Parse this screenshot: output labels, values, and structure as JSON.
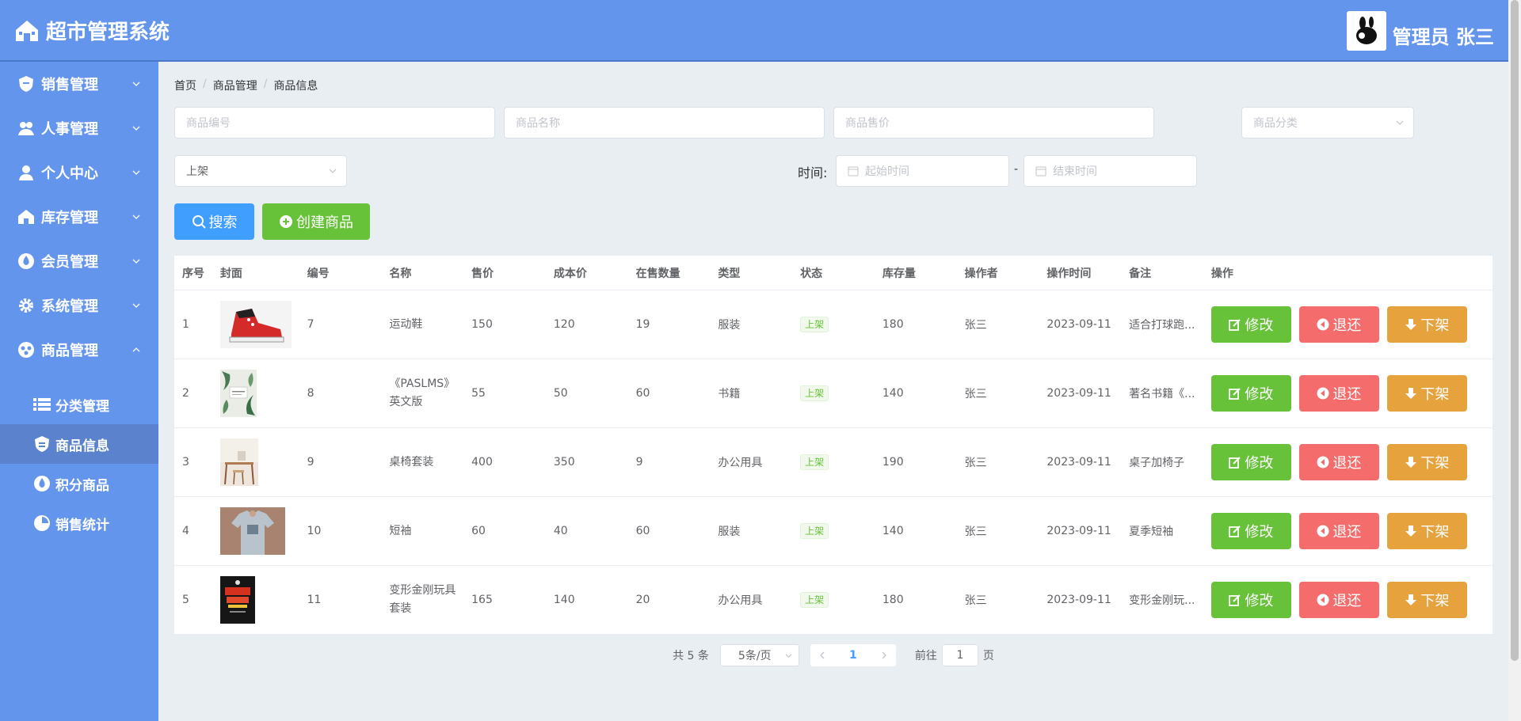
{
  "header": {
    "title": "超市管理系统",
    "user_label": "管理员 张三"
  },
  "sidebar": {
    "menus": [
      {
        "label": "销售管理",
        "icon": "shield-icon"
      },
      {
        "label": "人事管理",
        "icon": "people-icon"
      },
      {
        "label": "个人中心",
        "icon": "person-icon"
      },
      {
        "label": "库存管理",
        "icon": "warehouse-icon"
      },
      {
        "label": "会员管理",
        "icon": "drop-icon"
      },
      {
        "label": "系统管理",
        "icon": "gear-icon"
      },
      {
        "label": "商品管理",
        "icon": "goods-icon"
      }
    ],
    "submenu": [
      {
        "label": "分类管理",
        "icon": "list-icon"
      },
      {
        "label": "商品信息",
        "icon": "badge-icon"
      },
      {
        "label": "积分商品",
        "icon": "drop-icon"
      },
      {
        "label": "销售统计",
        "icon": "chart-icon"
      }
    ]
  },
  "breadcrumb": [
    "首页",
    "商品管理",
    "商品信息"
  ],
  "filters": {
    "code_placeholder": "商品编号",
    "name_placeholder": "商品名称",
    "price_placeholder": "商品售价",
    "category_placeholder": "商品分类",
    "status_value": "上架",
    "time_label": "时间:",
    "start_placeholder": "起始时间",
    "dash": "-",
    "end_placeholder": "结束时间"
  },
  "actions": {
    "search_label": "搜索",
    "create_label": "创建商品"
  },
  "table": {
    "columns": [
      "序号",
      "封面",
      "编号",
      "名称",
      "售价",
      "成本价",
      "在售数量",
      "类型",
      "状态",
      "库存量",
      "操作者",
      "操作时间",
      "备注",
      "操作"
    ],
    "rows": [
      {
        "index": "1",
        "cover": "red-sneaker",
        "code": "7",
        "name": "运动鞋",
        "price": "150",
        "cost": "120",
        "on_sale": "19",
        "type": "服装",
        "status": "上架",
        "stock": "180",
        "operator": "张三",
        "time": "2023-09-11",
        "note": "适合打球跑..."
      },
      {
        "index": "2",
        "cover": "book-cover",
        "code": "8",
        "name": "《PASLMS》英文版",
        "price": "55",
        "cost": "50",
        "on_sale": "60",
        "type": "书籍",
        "status": "上架",
        "stock": "140",
        "operator": "张三",
        "time": "2023-09-11",
        "note": "著名书籍《..."
      },
      {
        "index": "3",
        "cover": "desk-chair",
        "code": "9",
        "name": "桌椅套装",
        "price": "400",
        "cost": "350",
        "on_sale": "9",
        "type": "办公用具",
        "status": "上架",
        "stock": "190",
        "operator": "张三",
        "time": "2023-09-11",
        "note": "桌子加椅子"
      },
      {
        "index": "4",
        "cover": "tshirt",
        "code": "10",
        "name": "短袖",
        "price": "60",
        "cost": "40",
        "on_sale": "60",
        "type": "服装",
        "status": "上架",
        "stock": "140",
        "operator": "张三",
        "time": "2023-09-11",
        "note": "夏季短袖"
      },
      {
        "index": "5",
        "cover": "toy-box",
        "code": "11",
        "name": "变形金刚玩具套装",
        "price": "165",
        "cost": "140",
        "on_sale": "20",
        "type": "办公用具",
        "status": "上架",
        "stock": "180",
        "operator": "张三",
        "time": "2023-09-11",
        "note": "变形金刚玩..."
      }
    ],
    "op_labels": {
      "edit": "修改",
      "return": "退还",
      "off_shelf": "下架"
    }
  },
  "pagination": {
    "total": "共 5 条",
    "page_size": "5条/页",
    "current": "1",
    "goto_prefix": "前往",
    "goto_value": "1",
    "goto_suffix": "页"
  },
  "colors": {
    "primary": "#6495ed",
    "search": "#409eff",
    "success": "#67c23a",
    "danger": "#f56c6c",
    "warning": "#e6a23c"
  }
}
